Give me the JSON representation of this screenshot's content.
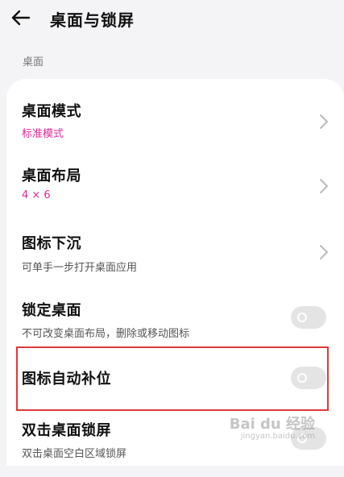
{
  "header": {
    "title": "桌面与锁屏",
    "back_icon": "arrow-left-icon"
  },
  "section": {
    "label": "桌面"
  },
  "rows": [
    {
      "title": "桌面模式",
      "subtitle": "标准模式",
      "control": "chevron"
    },
    {
      "title": "桌面布局",
      "subtitle": "4 × 6",
      "control": "chevron"
    },
    {
      "title": "图标下沉",
      "subtitle": "可单手一步打开桌面应用",
      "control": "chevron"
    },
    {
      "title": "锁定桌面",
      "subtitle": "不可改变桌面布局，删除或移动图标",
      "control": "toggle",
      "on": false
    },
    {
      "title": "图标自动补位",
      "subtitle": "",
      "control": "toggle",
      "on": false
    },
    {
      "title": "双击桌面锁屏",
      "subtitle": "双击桌面空白区域锁屏",
      "control": "toggle",
      "on": false
    }
  ],
  "watermark": {
    "text": "Bai du 经验",
    "sub": "jingyan.baidu.com"
  },
  "colors": {
    "accent": "#e0289a",
    "highlight": "#e03838",
    "background": "#f4f4f6"
  }
}
